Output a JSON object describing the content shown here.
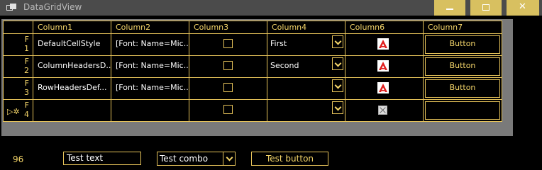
{
  "window": {
    "title": "DataGridView",
    "colors": {
      "titlebar": "#4b4b4b",
      "window_button": "#d8c060",
      "grid_border": "#e6c35a",
      "header_text": "#f5d66a"
    }
  },
  "grid": {
    "columns": [
      "Column1",
      "Column2",
      "Column3",
      "Column4",
      "Column6",
      "Column7"
    ],
    "rows": [
      {
        "header": "F\n1",
        "col1": "DefaultCellStyle",
        "col2": "[Font: Name=Mic...",
        "combo": "First",
        "image": "red-a-logo-icon",
        "button": "Button"
      },
      {
        "header": "F\n2",
        "col1": "ColumnHeadersD...",
        "col2": "[Font: Name=Mic...",
        "combo": "Second",
        "image": "red-a-logo-icon",
        "button": "Button"
      },
      {
        "header": "F\n3",
        "col1": "RowHeadersDef...",
        "col2": "[Font: Name=Mic...",
        "combo": "",
        "image": "red-a-logo-icon",
        "button": "Button"
      }
    ],
    "new_row": {
      "header": "F\n4",
      "icon": "new-row-edit-icon",
      "image": "missing-image-icon",
      "button": ""
    }
  },
  "controls": {
    "number_label": "96",
    "text_box_value": "Test text",
    "combo_value": "Test combo",
    "button_label": "Test button"
  }
}
